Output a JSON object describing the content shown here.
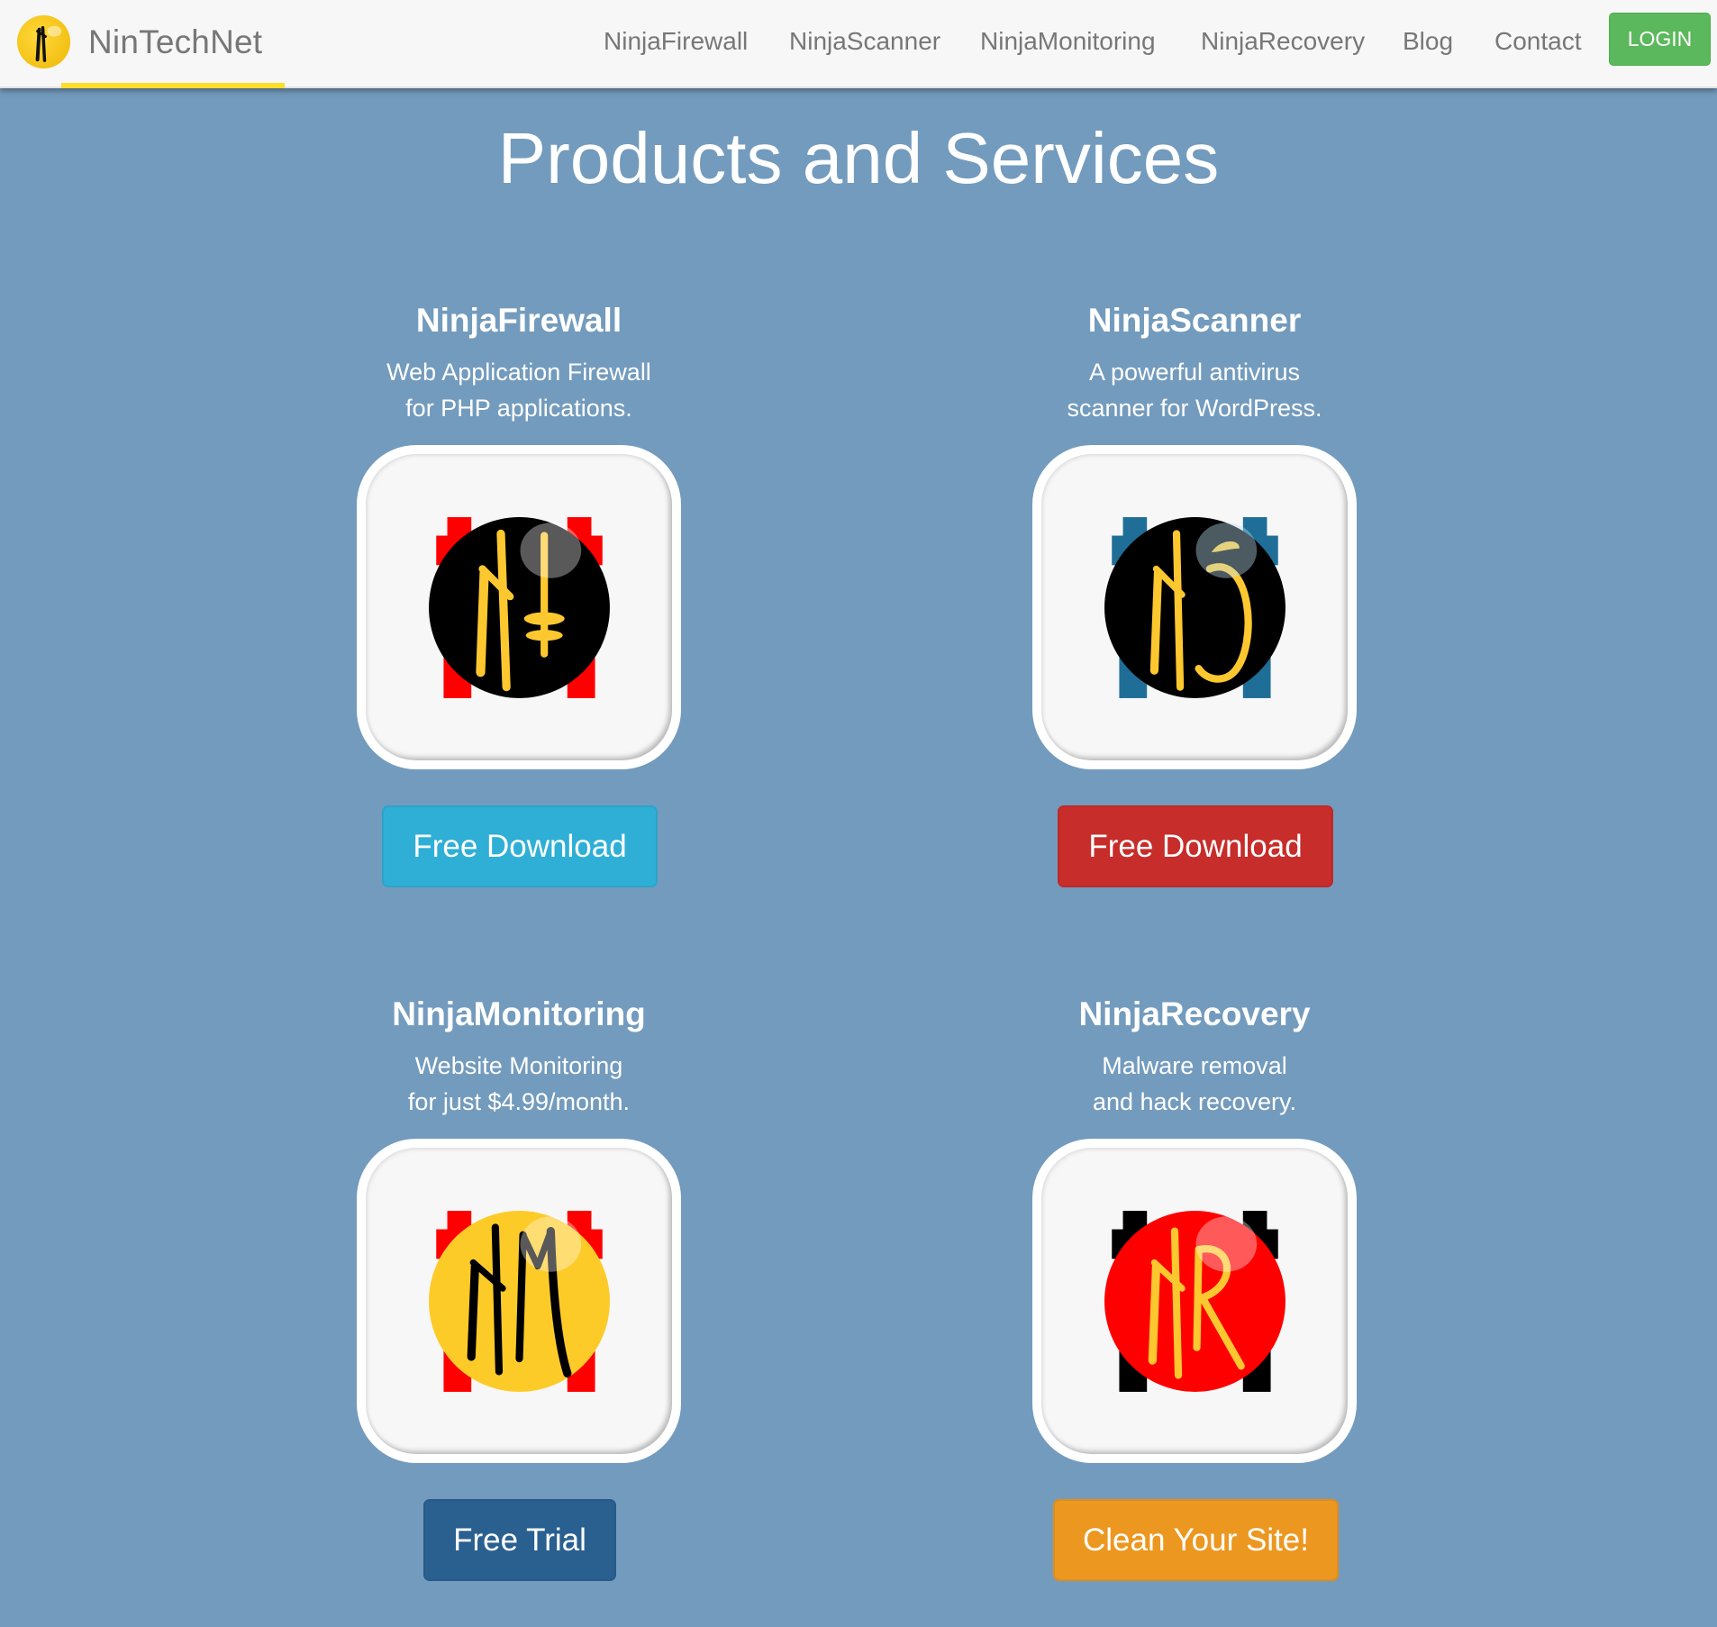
{
  "header": {
    "brand": "NinTechNet",
    "nav": [
      {
        "label": "NinjaFirewall"
      },
      {
        "label": "NinjaScanner"
      },
      {
        "label": "NinjaMonitoring"
      },
      {
        "label": "NinjaRecovery"
      },
      {
        "label": "Blog"
      },
      {
        "label": "Contact"
      }
    ],
    "login_label": "LOGIN",
    "active_underline_color": "#fddd2a",
    "login_color": "#5cb85c"
  },
  "page": {
    "title": "Products and Services",
    "background": "#739bbd"
  },
  "products": [
    {
      "name": "NinjaFirewall",
      "desc_line1": "Web Application Firewall",
      "desc_line2": "for PHP applications.",
      "icon": "ninjafirewall-logo-icon",
      "cta_label": "Free Download",
      "cta_color": "#2fafd6"
    },
    {
      "name": "NinjaScanner",
      "desc_line1": "A powerful antivirus",
      "desc_line2": "scanner for WordPress.",
      "icon": "ninjascanner-logo-icon",
      "cta_label": "Free Download",
      "cta_color": "#c72d2a"
    },
    {
      "name": "NinjaMonitoring",
      "desc_line1": "Website Monitoring",
      "desc_line2": "for just $4.99/month.",
      "icon": "ninjamonitoring-logo-icon",
      "cta_label": "Free Trial",
      "cta_color": "#2a6090"
    },
    {
      "name": "NinjaRecovery",
      "desc_line1": "Malware removal",
      "desc_line2": "and hack recovery.",
      "icon": "ninjarecovery-logo-icon",
      "cta_label": "Clean Your Site!",
      "cta_color": "#ec971f"
    }
  ]
}
